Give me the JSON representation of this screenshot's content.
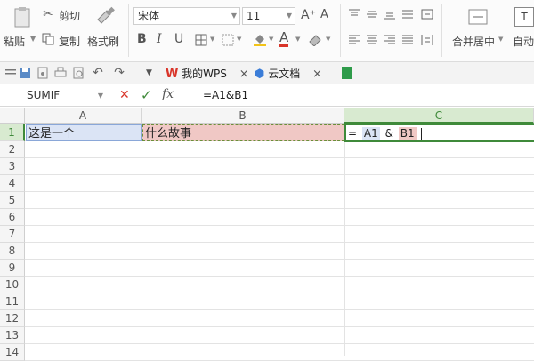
{
  "ribbon": {
    "cut_label": "剪切",
    "copy_label": "复制",
    "paste_label": "粘贴",
    "format_painter_label": "格式刷",
    "font_name": "宋体",
    "font_size": "11",
    "bold": "B",
    "italic": "I",
    "underline": "U",
    "font_color_letter": "A",
    "merge_center_label": "合并居中",
    "auto_wrap_label": "自动",
    "grow_font": "A⁺",
    "shrink_font": "A⁻",
    "wrap_icon_letter": "T"
  },
  "tabs": [
    {
      "label": "我的WPS",
      "close": "×"
    },
    {
      "label": "云文档",
      "close": "×"
    }
  ],
  "formula_bar": {
    "name_box": "SUMIF",
    "cancel": "✕",
    "enter": "✓",
    "fx": "fx",
    "formula": "=A1&B1"
  },
  "grid": {
    "columns": [
      "A",
      "B",
      "C"
    ],
    "rows": [
      "1",
      "2",
      "3",
      "4",
      "5",
      "6",
      "7",
      "8",
      "9",
      "10",
      "11",
      "12",
      "13",
      "14"
    ],
    "cells": {
      "A1": "这是一个",
      "B1": "什么故事",
      "C1_eq": "=",
      "C1_ref1": "A1",
      "C1_amp": "&",
      "C1_ref2": "B1"
    }
  },
  "colors": {
    "ref_a": "#dbe4f5",
    "ref_b": "#f0c8c5",
    "active_col": "#d8ead0",
    "active_border": "#3f8a3a",
    "wps_red": "#d9352a"
  }
}
